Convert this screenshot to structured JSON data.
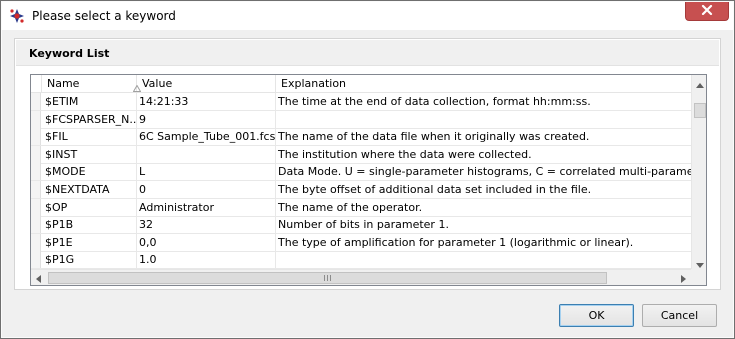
{
  "window": {
    "title": "Please select a keyword",
    "close_icon": "close-icon",
    "app_icon": "flowjo-app-icon"
  },
  "group": {
    "title": "Keyword List"
  },
  "table": {
    "columns": [
      "Name",
      "Value",
      "Explanation"
    ],
    "sort_column": "Name",
    "sort_direction": "ascending",
    "rows": [
      {
        "name": "$ETIM",
        "value": "14:21:33",
        "explanation": "The time at the end of data collection, format hh:mm:ss."
      },
      {
        "name": "$FCSPARSER_N...",
        "value": "9",
        "explanation": ""
      },
      {
        "name": "$FIL",
        "value": "6C Sample_Tube_001.fcs",
        "explanation": "The name of the data file when it originally was created."
      },
      {
        "name": "$INST",
        "value": "",
        "explanation": "The institution where the data were collected."
      },
      {
        "name": "$MODE",
        "value": "L",
        "explanation": "Data Mode.  U = single-parameter histograms, C = correlated multi-parameter hi"
      },
      {
        "name": "$NEXTDATA",
        "value": "0",
        "explanation": "The byte offset of additional data set included in the file."
      },
      {
        "name": "$OP",
        "value": "Administrator",
        "explanation": "The name of the operator."
      },
      {
        "name": "$P1B",
        "value": "32",
        "explanation": "Number of bits in parameter 1."
      },
      {
        "name": "$P1E",
        "value": "0,0",
        "explanation": "The type of amplification for parameter 1 (logarithmic or linear)."
      },
      {
        "name": "$P1G",
        "value": "1.0",
        "explanation": ""
      }
    ]
  },
  "buttons": {
    "ok": "OK",
    "cancel": "Cancel"
  }
}
